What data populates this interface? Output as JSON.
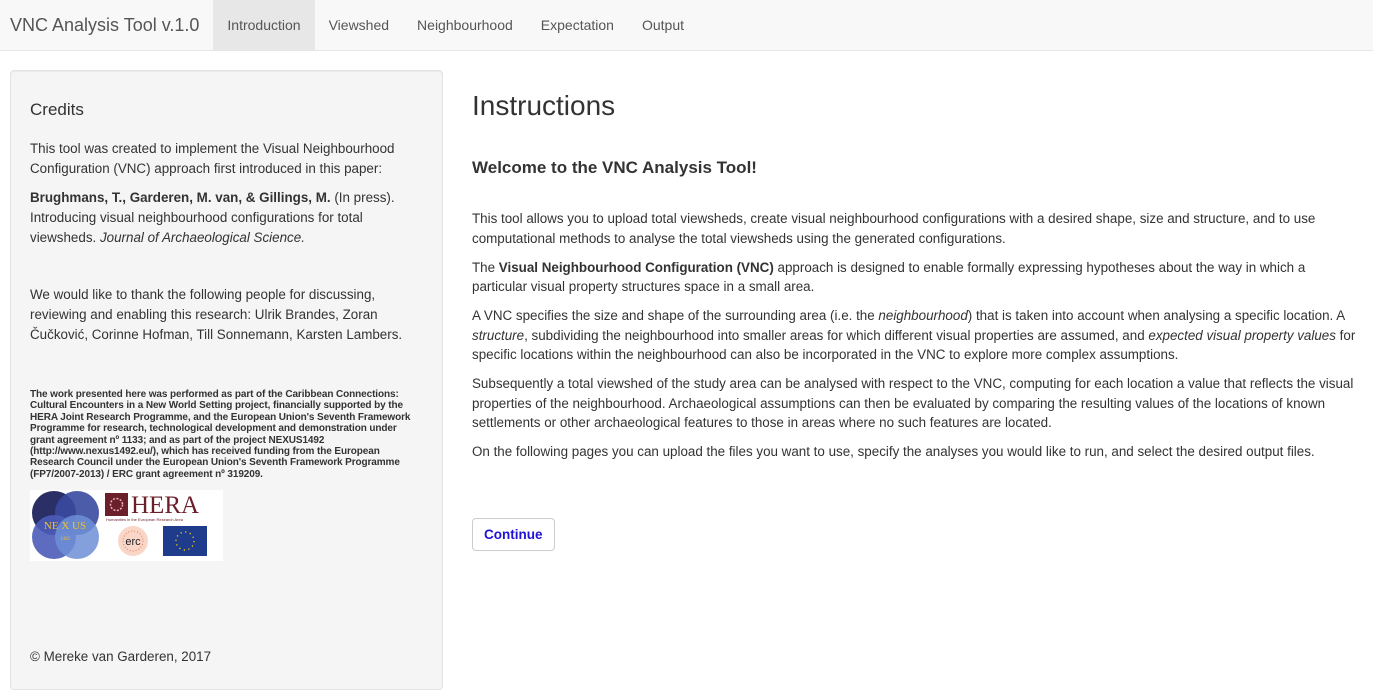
{
  "navbar": {
    "brand": "VNC Analysis Tool v.1.0",
    "tabs": [
      {
        "label": "Introduction",
        "active": true
      },
      {
        "label": "Viewshed",
        "active": false
      },
      {
        "label": "Neighbourhood",
        "active": false
      },
      {
        "label": "Expectation",
        "active": false
      },
      {
        "label": "Output",
        "active": false
      }
    ]
  },
  "sidebar": {
    "title": "Credits",
    "intro": "This tool was created to implement the Visual Neighbourhood Configuration (VNC) approach first introduced in this paper:",
    "citation_authors": "Brughmans, T., Garderen, M. van, & Gillings, M.",
    "citation_status": " (In press). Introducing visual neighbourhood configurations for total viewsheds. ",
    "citation_journal": "Journal of Archaeological Science.",
    "thanks": "We would like to thank the following people for discussing, reviewing and enabling this research: Ulrik Brandes, Zoran Čučković, Corinne Hofman, Till Sonnemann, Karsten Lambers.",
    "funding": "The work presented here was performed as part of the Caribbean Connections: Cultural Encounters in a New World Setting project, financially supported by the HERA Joint Research Programme, and the European Union's Seventh Framework Programme for research, technological development and demonstration under grant agreement nº 1133; and as part of the project NEXUS1492 (http://www.nexus1492.eu/), which has received funding from the European Research Council under the European Union's Seventh Framework Programme (FP7/2007-2013) / ERC grant agreement nº 319209.",
    "logos": {
      "nexus": {
        "text": "NE X US",
        "year": "1492"
      },
      "hera": {
        "text": "HERA",
        "subtitle": "Humanities in the European Research Area"
      },
      "erc": {
        "text": "erc"
      }
    },
    "copyright": "© Mereke van Garderen, 2017"
  },
  "main": {
    "title": "Instructions",
    "welcome": "Welcome to the VNC Analysis Tool!",
    "p1": "This tool allows you to upload total viewsheds, create visual neighbourhood configurations with a desired shape, size and structure, and to use computational methods to analyse the total viewsheds using the generated configurations.",
    "p2_pre": "The ",
    "p2_bold": "Visual Neighbourhood Configuration (VNC)",
    "p2_post": " approach is designed to enable formally expressing hypotheses about the way in which a particular visual property structures space in a small area.",
    "p3_a": "A VNC specifies the size and shape of the surrounding area (i.e. the ",
    "p3_neighbourhood": "neighbourhood",
    "p3_b": ") that is taken into account when analysing a specific location. A ",
    "p3_structure": "structure",
    "p3_c": ", subdividing the neighbourhood into smaller areas for which different visual properties are assumed, and ",
    "p3_expected": "expected visual property values",
    "p3_d": " for specific locations within the neighbourhood can also be incorporated in the VNC to explore more complex assumptions.",
    "p4": "Subsequently a total viewshed of the study area can be analysed with respect to the VNC, computing for each location a value that reflects the visual properties of the neighbourhood. Archaeological assumptions can then be evaluated by comparing the resulting values of the locations of known settlements or other archaeological features to those in areas where no such features are located.",
    "p5": "On the following pages you can upload the files you want to use, specify the analyses you would like to run, and select the desired output files.",
    "continue_label": "Continue"
  },
  "colors": {
    "navbar_bg": "#f8f8f8",
    "active_tab_bg": "#e7e7e7",
    "sidebar_bg": "#f5f5f5",
    "continue_text": "#2112d9"
  }
}
